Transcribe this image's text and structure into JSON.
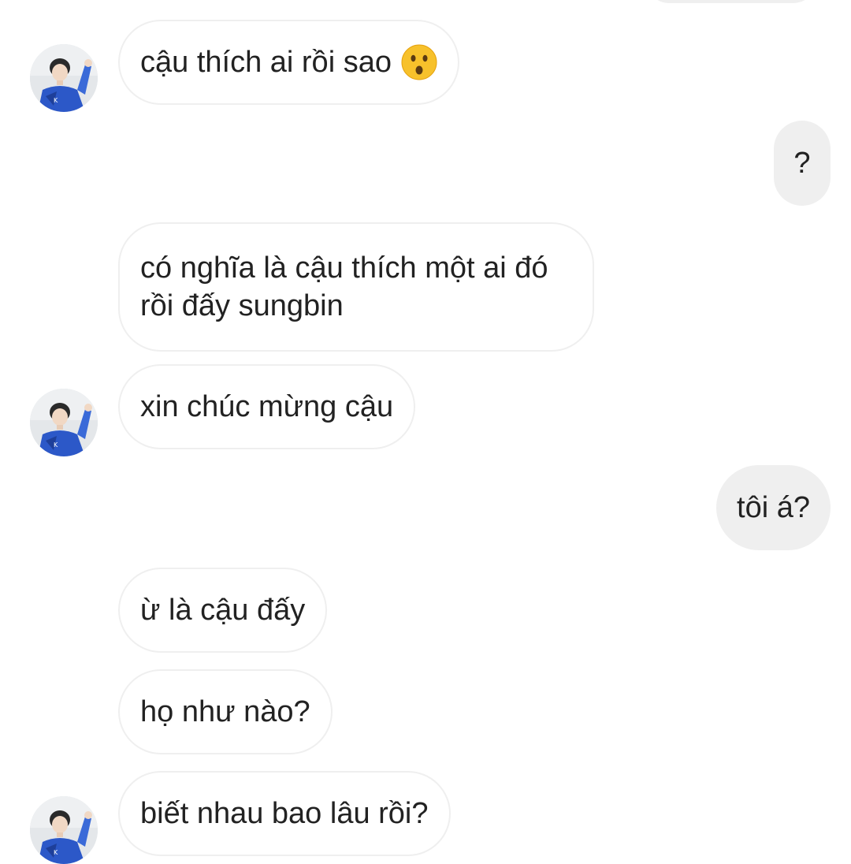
{
  "conversation": {
    "messages": [
      {
        "id": "m1",
        "direction": "incoming",
        "text": "cậu thích ai rồi sao",
        "emoji": "hushed-face-emoji"
      },
      {
        "id": "m2",
        "direction": "outgoing",
        "text": "?"
      },
      {
        "id": "m3",
        "direction": "incoming",
        "text": "có nghĩa là cậu thích một ai đó rồi đấy sungbin"
      },
      {
        "id": "m4",
        "direction": "incoming",
        "text": "xin chúc mừng cậu"
      },
      {
        "id": "m5",
        "direction": "outgoing",
        "text": "tôi á?"
      },
      {
        "id": "m6",
        "direction": "incoming",
        "text": "ừ là cậu đấy"
      },
      {
        "id": "m7",
        "direction": "incoming",
        "text": "họ như nào?"
      },
      {
        "id": "m8",
        "direction": "incoming",
        "text": "biết nhau bao lâu rồi?"
      }
    ]
  },
  "colors": {
    "incoming_bubble_bg": "#ffffff",
    "incoming_bubble_border": "#efefef",
    "outgoing_bubble_bg": "#efefef",
    "text": "#222222"
  },
  "icons": {
    "avatar": "contact-avatar",
    "emoji": "hushed-face-emoji"
  }
}
